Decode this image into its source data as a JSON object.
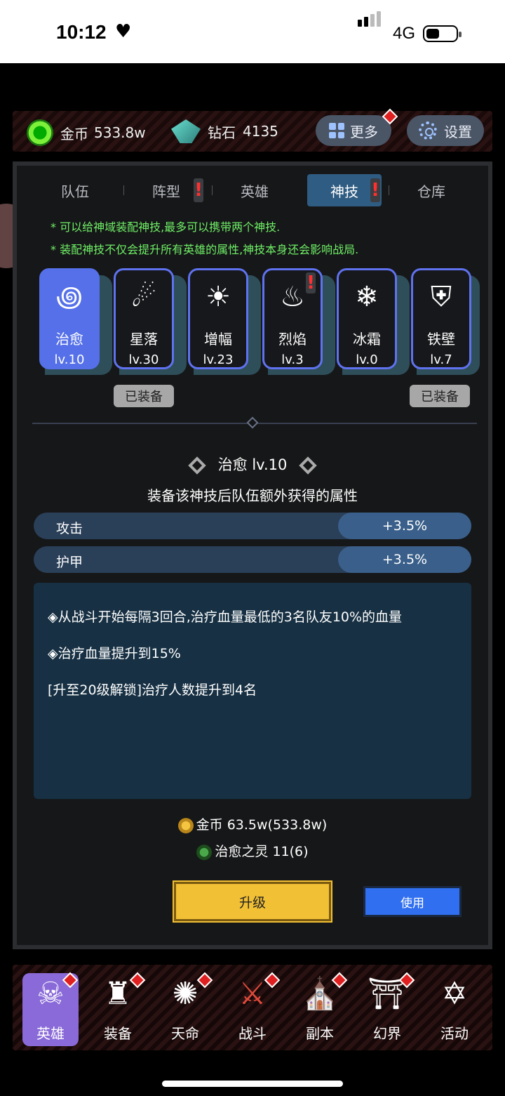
{
  "status_bar": {
    "time": "10:12",
    "network": "4G"
  },
  "resources": {
    "gold_label": "金币",
    "gold_value": "533.8w",
    "diamond_label": "钻石",
    "diamond_value": "4135",
    "more_label": "更多",
    "settings_label": "设置"
  },
  "tabs": [
    {
      "label": "队伍"
    },
    {
      "label": "阵型",
      "alert": "!"
    },
    {
      "label": "英雄"
    },
    {
      "label": "神技",
      "alert": "!",
      "active": true
    },
    {
      "label": "仓库"
    }
  ],
  "hints": [
    "* 可以给神域装配神技,最多可以携带两个神技.",
    "* 装配神技不仅会提升所有英雄的属性,神技本身还会影响战局."
  ],
  "skills": [
    {
      "name": "治愈",
      "level": "lv.10",
      "icon": "swirl-icon",
      "selected": true
    },
    {
      "name": "星落",
      "level": "lv.30",
      "icon": "meteor-icon",
      "equipped_label": "已装备"
    },
    {
      "name": "增幅",
      "level": "lv.23",
      "icon": "aura-figure-icon"
    },
    {
      "name": "烈焰",
      "level": "lv.3",
      "icon": "flame-icon",
      "alert": "!"
    },
    {
      "name": "冰霜",
      "level": "lv.0",
      "icon": "snow-icon"
    },
    {
      "name": "铁壁",
      "level": "lv.7",
      "icon": "shield-wall-icon",
      "equipped_label": "已装备"
    }
  ],
  "detail": {
    "title": "治愈  lv.10",
    "subtitle": "装备该神技后队伍额外获得的属性",
    "stats": [
      {
        "label": "攻击",
        "value": "+3.5%"
      },
      {
        "label": "护甲",
        "value": "+3.5%"
      }
    ],
    "description": [
      "◈从战斗开始每隔3回合,治疗血量最低的3名队友10%的血量",
      "◈治疗血量提升到15%",
      "[升至20级解锁]治疗人数提升到4名"
    ],
    "cost_gold": "金币 63.5w(533.8w)",
    "cost_spirit": "治愈之灵 11(6)",
    "upgrade_label": "升级",
    "use_label": "使用"
  },
  "bottom_nav": [
    {
      "label": "英雄",
      "icon": "hero-icon",
      "active": true
    },
    {
      "label": "装备",
      "icon": "armor-icon"
    },
    {
      "label": "天命",
      "icon": "destiny-icon"
    },
    {
      "label": "战斗",
      "icon": "crossed-swords-icon"
    },
    {
      "label": "副本",
      "icon": "dungeon-icon"
    },
    {
      "label": "幻界",
      "icon": "gate-icon"
    },
    {
      "label": "活动",
      "icon": "scroll-icon"
    }
  ],
  "colors": {
    "accent_blue": "#5570e8",
    "tab_active": "#2f5c82",
    "hint_green": "#6ff067",
    "upgrade_yellow": "#f2c035",
    "use_blue": "#2f6ff0",
    "alert_red": "#ff3030"
  }
}
